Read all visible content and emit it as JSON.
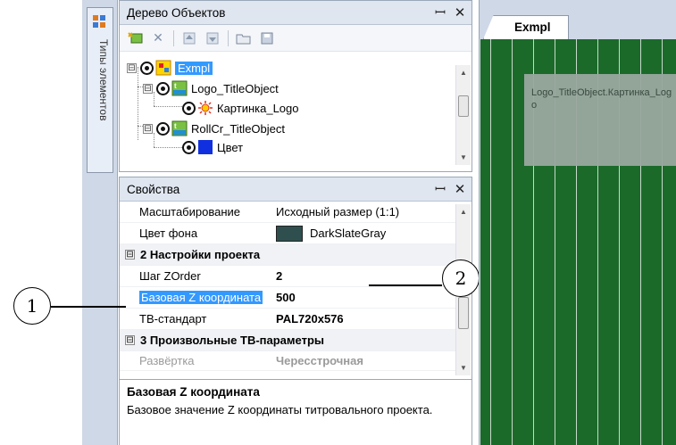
{
  "side_tab": {
    "label": "Типы элементов",
    "icon": "element-types-icon"
  },
  "tree_panel": {
    "title": "Дерево Объектов",
    "pin_icon": "pin-icon",
    "close_icon": "close-icon",
    "toolbar": [
      "add-object-icon",
      "delete-icon",
      "move-up-icon",
      "move-down-icon",
      "open-folder-icon",
      "save-icon"
    ],
    "nodes": [
      {
        "label": "Exmpl",
        "icon": "project-icon",
        "selected": true,
        "expander": "⊟"
      },
      {
        "label": "Logo_TitleObject",
        "icon": "title-object-icon",
        "expander": "⊟"
      },
      {
        "label": "Картинка_Logo",
        "icon": "picture-icon"
      },
      {
        "label": "RollCr_TitleObject",
        "icon": "title-object-icon",
        "expander": "⊟"
      },
      {
        "label": "Цвет",
        "icon": "color-icon"
      }
    ]
  },
  "props_panel": {
    "title": "Свойства",
    "rows": [
      {
        "name": "Масштабирование",
        "value": "Исходный размер (1:1)"
      },
      {
        "name": "Цвет фона",
        "value": "DarkSlateGray",
        "swatch": "#2f4f4f"
      },
      {
        "category": "2 Настройки проекта",
        "expander": "⊟"
      },
      {
        "name": "Шаг ZOrder",
        "value": "2"
      },
      {
        "name": "Базовая Z координата",
        "value": "500",
        "selected": true
      },
      {
        "name": "ТВ-стандарт",
        "value": "PAL720x576"
      },
      {
        "category": "3 Произвольные ТВ-параметры",
        "expander": "⊟"
      },
      {
        "name": "Развёртка",
        "value": "Чересстрочная",
        "disabled": true
      }
    ],
    "description": {
      "title": "Базовая Z координата",
      "text": "Базовое значение Z координаты титровального проекта."
    }
  },
  "callouts": {
    "one": "1",
    "two": "2"
  },
  "canvas": {
    "tab_label": "Exmpl",
    "logo_object_text": "Logo_TitleObject.Картинка_Logo",
    "background_color": "#1b6a2a"
  }
}
